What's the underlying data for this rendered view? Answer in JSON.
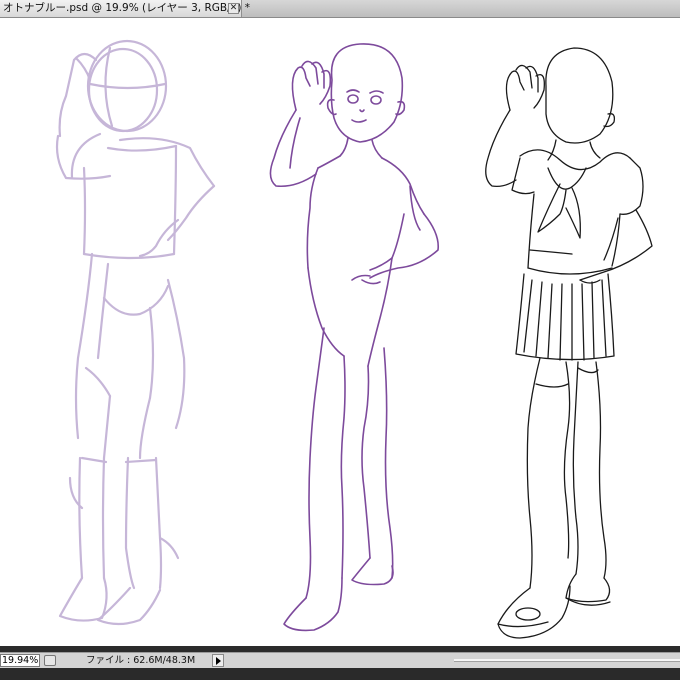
{
  "document": {
    "tab_title": "オトナブルー.psd @ 19.9% (レイヤー 3, RGB/8) *",
    "close_glyph": "✕"
  },
  "canvas": {
    "background": "#ffffff",
    "figures": [
      {
        "name": "rough-sketch-figure",
        "stroke": "#c6b6d8"
      },
      {
        "name": "body-lineart-figure",
        "stroke": "#7d4a9c"
      },
      {
        "name": "uniform-lineart-figure",
        "stroke": "#1a1a1a"
      }
    ]
  },
  "status_bar": {
    "zoom": "19.94%",
    "file_info": "ファイル : 62.6M/48.3M"
  }
}
